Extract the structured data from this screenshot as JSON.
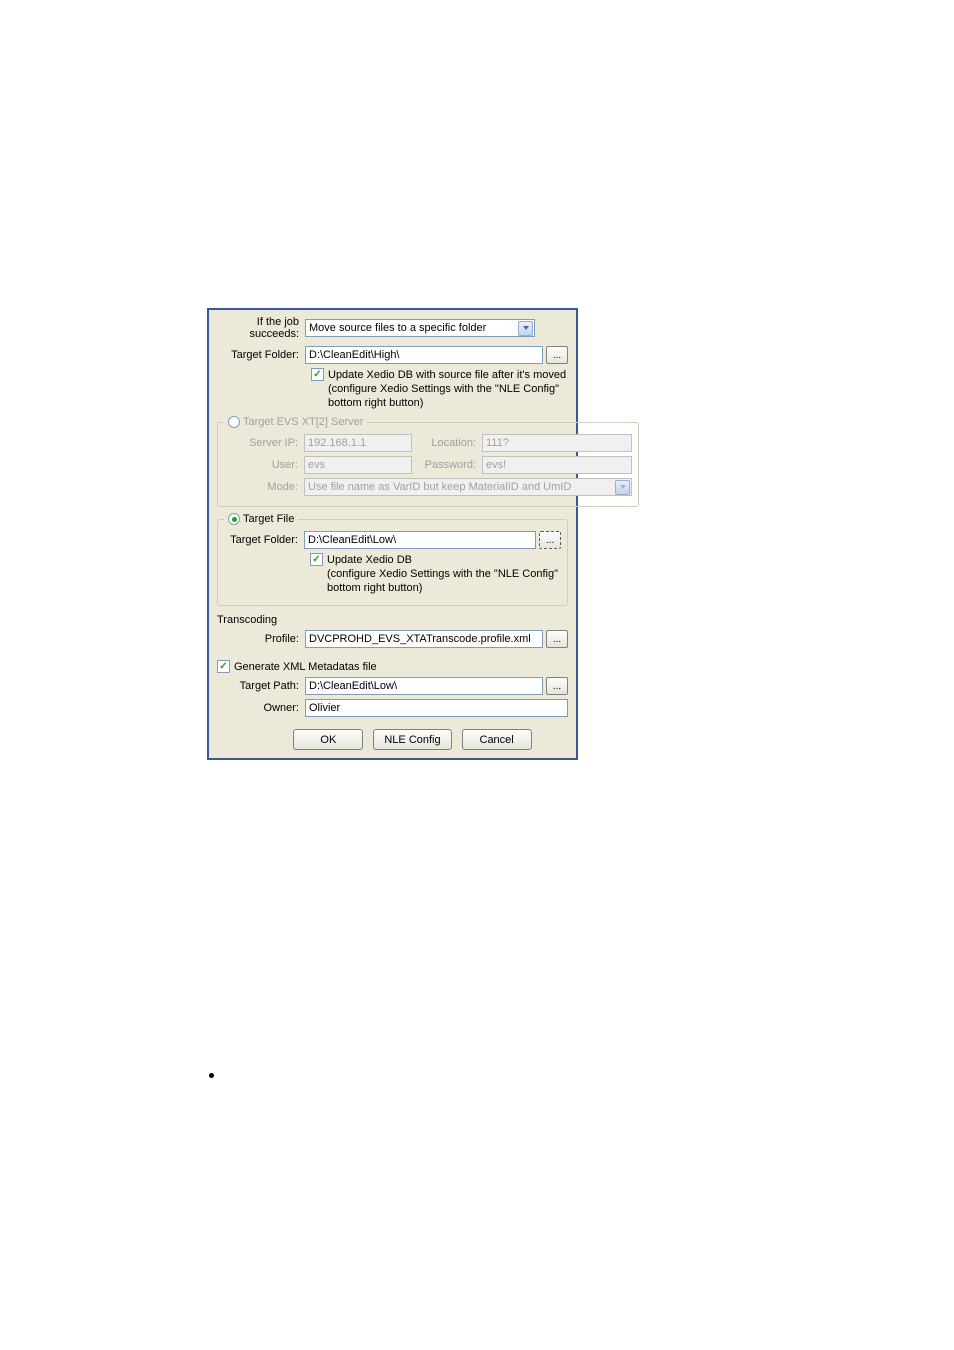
{
  "job_succeeds": {
    "label": "If the job succeeds:",
    "value": "Move source files to a specific folder"
  },
  "target_folder_high": {
    "label": "Target Folder:",
    "value": "D:\\CleanEdit\\High\\",
    "checkbox_label": "Update Xedio DB with source file after it's moved",
    "subtext": "(configure Xedio Settings with the \"NLE Config\" bottom right button)"
  },
  "target_evs": {
    "legend": "Target EVS XT[2] Server",
    "server_ip_label": "Server IP:",
    "server_ip_value": "192.168.1.1",
    "location_label": "Location:",
    "location_value": "111?",
    "user_label": "User:",
    "user_value": "evs",
    "password_label": "Password:",
    "password_value": "evs!",
    "mode_label": "Mode:",
    "mode_value": "Use file name as VarID but keep MaterialID and UmID"
  },
  "target_file": {
    "legend": "Target File",
    "folder_label": "Target Folder:",
    "folder_value": "D:\\CleanEdit\\Low\\",
    "checkbox_label": "Update Xedio DB",
    "subtext": "(configure Xedio Settings with the \"NLE Config\" bottom right button)"
  },
  "transcoding": {
    "title": "Transcoding",
    "profile_label": "Profile:",
    "profile_value": "DVCPROHD_EVS_XTATranscode.profile.xml"
  },
  "xml_metadata": {
    "checkbox_label": "Generate XML Metadatas file",
    "target_path_label": "Target Path:",
    "target_path_value": "D:\\CleanEdit\\Low\\",
    "owner_label": "Owner:",
    "owner_value": "Olivier"
  },
  "buttons": {
    "ok": "OK",
    "nle_config": "NLE Config",
    "cancel": "Cancel"
  },
  "browse": "..."
}
